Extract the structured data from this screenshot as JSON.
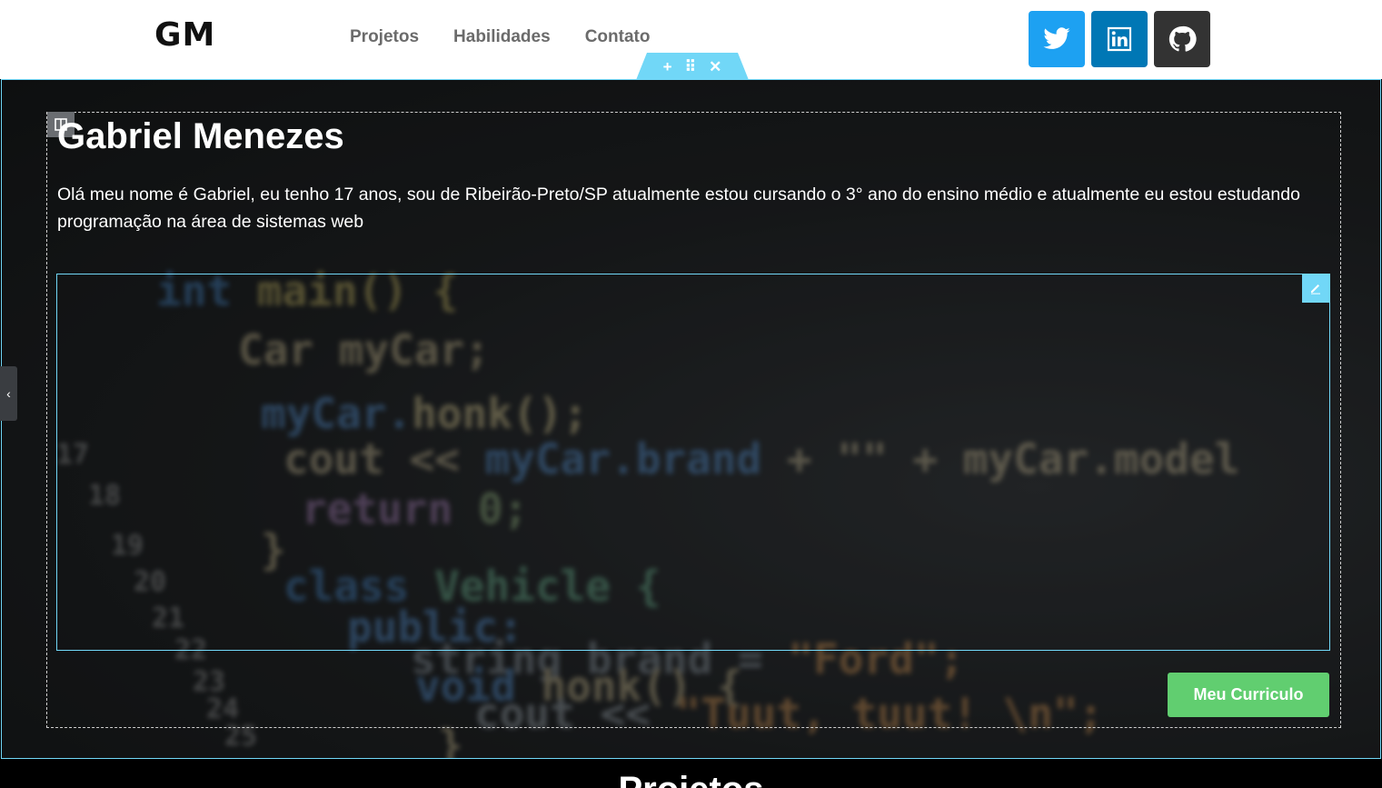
{
  "header": {
    "logo": "GM",
    "nav": [
      "Projetos",
      "Habilidades",
      "Contato"
    ],
    "socials": [
      {
        "name": "twitter",
        "icon": "twitter-icon",
        "color": "#1da1f2"
      },
      {
        "name": "linkedin",
        "icon": "linkedin-icon",
        "color": "#0077b5"
      },
      {
        "name": "github",
        "icon": "github-icon",
        "color": "#333333"
      }
    ]
  },
  "editor": {
    "section_handle": {
      "add": "+",
      "drag": "⠿",
      "close": "✕"
    },
    "accent": "#71d7f7",
    "panel_toggle": "‹"
  },
  "hero": {
    "name": "Gabriel Menezes",
    "bio": "Olá meu nome é Gabriel, eu tenho 17 anos, sou de Ribeirão-Preto/SP atualmente estou cursando o 3° ano do ensino médio e atualmente eu estou estudando programação na área de sistemas web",
    "cv_button": "Meu Curriculo",
    "cv_button_color": "#61ce70"
  },
  "next_section": {
    "title": "Projetos"
  }
}
